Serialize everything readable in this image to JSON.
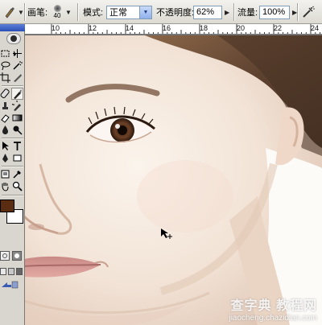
{
  "options_bar": {
    "brush_label": "画笔:",
    "brush_size": "40",
    "mode_label": "模式:",
    "mode_value": "正常",
    "opacity_label": "不透明度:",
    "opacity_value": "62%",
    "flow_label": "流量:",
    "flow_value": "100%"
  },
  "ruler": {
    "marks": [
      "10",
      "12",
      "14",
      "16",
      "18",
      "20",
      "22",
      "24"
    ]
  },
  "watermark": {
    "main": "查字典 教程网",
    "sub": "jiaocheng.chazidian.com"
  },
  "colors": {
    "foreground": "#5a2d12",
    "background": "#ffffff",
    "panel": "#d8d6ce",
    "title_bar": "#2b4fb6"
  },
  "icons": {
    "tool_preset": "brush-tool-icon",
    "airbrush": "airbrush-icon",
    "cursor": "brush-cursor-icon"
  }
}
